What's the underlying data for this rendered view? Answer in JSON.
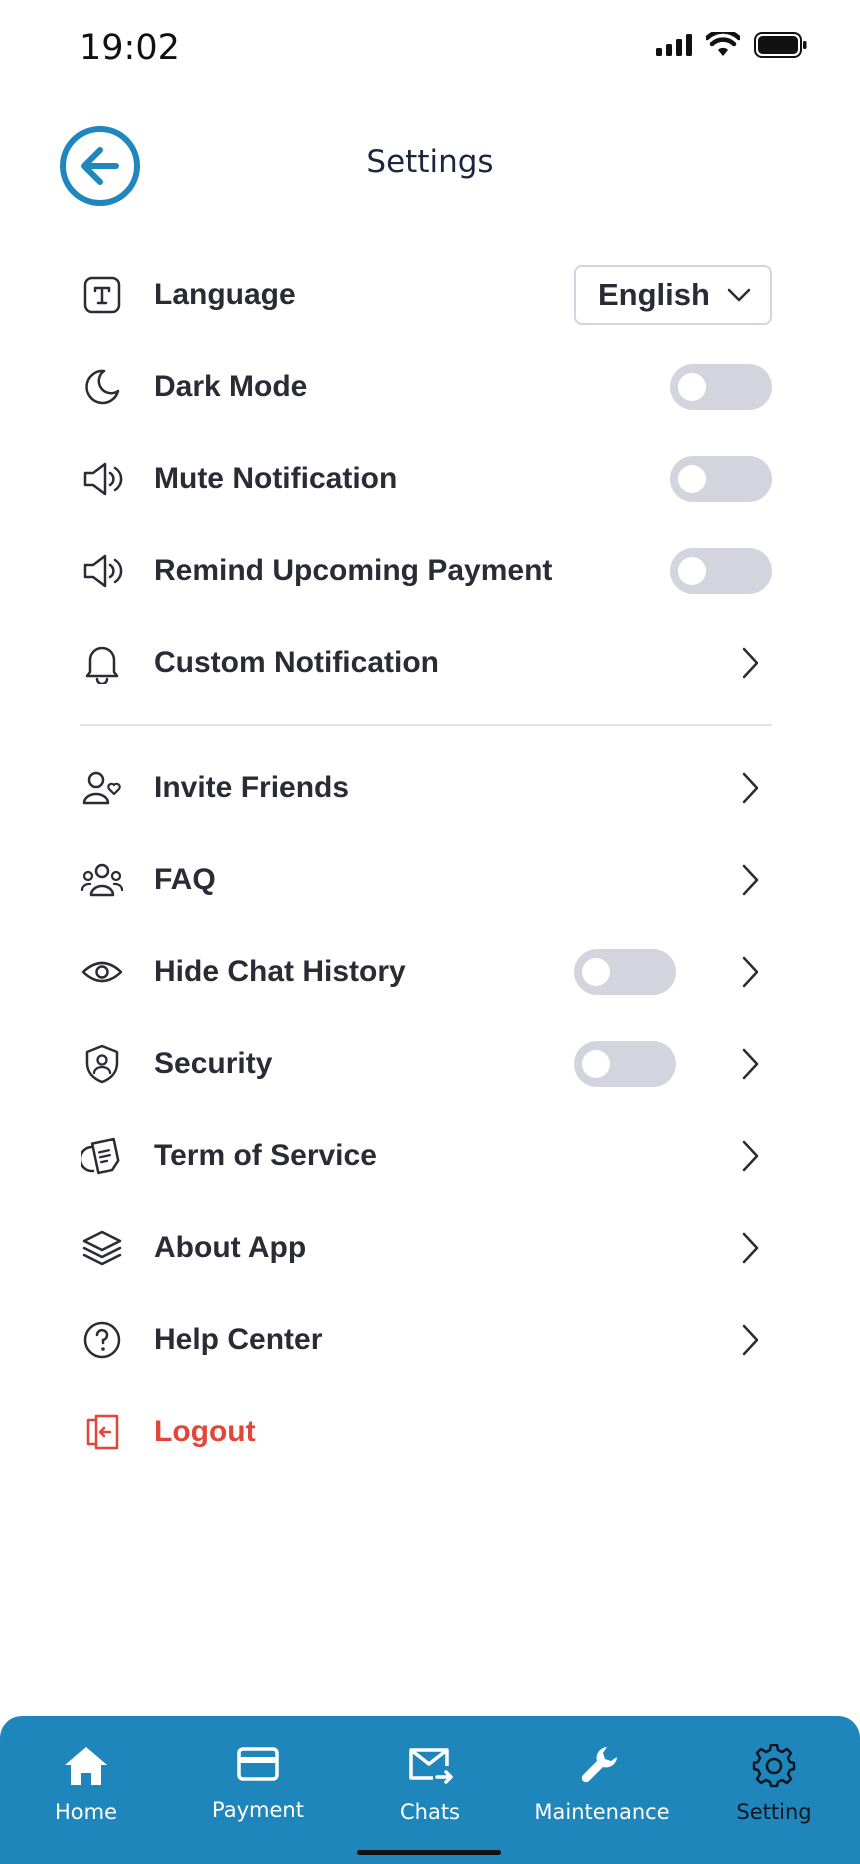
{
  "status_bar": {
    "time": "19:02"
  },
  "header": {
    "title": "Settings"
  },
  "settings": {
    "language": {
      "label": "Language",
      "selected": "English"
    },
    "dark_mode": {
      "label": "Dark Mode",
      "enabled": false
    },
    "mute_notification": {
      "label": "Mute Notification",
      "enabled": false
    },
    "remind_upcoming_payment": {
      "label": "Remind Upcoming Payment",
      "enabled": false
    },
    "custom_notification": {
      "label": "Custom Notification"
    },
    "invite_friends": {
      "label": "Invite Friends"
    },
    "faq": {
      "label": "FAQ"
    },
    "hide_chat_history": {
      "label": "Hide Chat History",
      "enabled": false
    },
    "security": {
      "label": "Security",
      "enabled": false
    },
    "term_of_service": {
      "label": "Term of Service"
    },
    "about_app": {
      "label": "About App"
    },
    "help_center": {
      "label": "Help Center"
    },
    "logout": {
      "label": "Logout"
    }
  },
  "bottom_nav": {
    "active": "Setting",
    "items": [
      {
        "label": "Home",
        "icon": "home-icon"
      },
      {
        "label": "Payment",
        "icon": "card-icon"
      },
      {
        "label": "Chats",
        "icon": "mail-icon"
      },
      {
        "label": "Maintenance",
        "icon": "wrench-icon"
      },
      {
        "label": "Setting",
        "icon": "gear-icon"
      }
    ]
  },
  "colors": {
    "accent": "#1f86bc",
    "danger": "#e34638",
    "toggle_off": "#d3d4de",
    "text": "#2b2b36"
  }
}
